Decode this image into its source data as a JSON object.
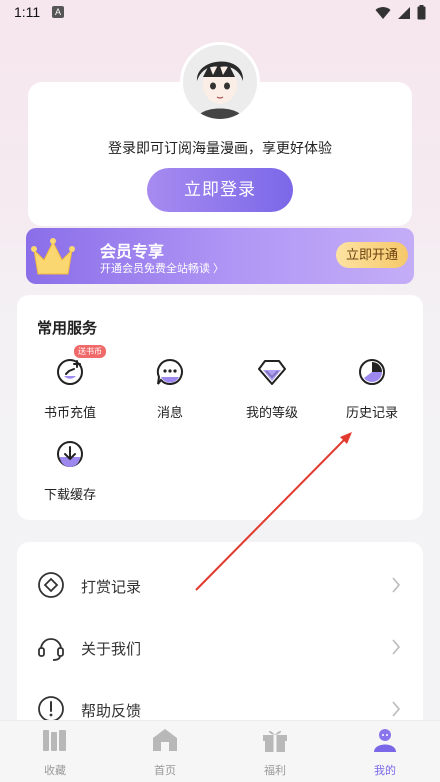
{
  "status": {
    "time": "1:11",
    "notif": "A"
  },
  "login": {
    "tip": "登录即可订阅海量漫画，享更好体验",
    "button": "立即登录"
  },
  "vip": {
    "title": "会员专享",
    "subtitle": "开通会员免费全站畅读 〉",
    "button": "立即开通"
  },
  "services": {
    "title": "常用服务",
    "items": [
      {
        "label": "书币充值",
        "badge": "送书币",
        "icon": "coin-icon"
      },
      {
        "label": "消息",
        "icon": "message-icon"
      },
      {
        "label": "我的等级",
        "icon": "diamond-icon"
      },
      {
        "label": "历史记录",
        "icon": "history-icon"
      },
      {
        "label": "下载缓存",
        "icon": "download-icon"
      }
    ]
  },
  "menu": {
    "items": [
      {
        "label": "打赏记录",
        "icon": "reward-icon"
      },
      {
        "label": "关于我们",
        "icon": "headset-icon"
      },
      {
        "label": "帮助反馈",
        "icon": "help-icon"
      }
    ]
  },
  "tabs": [
    {
      "label": "收藏",
      "icon": "bookshelf-icon"
    },
    {
      "label": "首页",
      "icon": "home-icon"
    },
    {
      "label": "福利",
      "icon": "gift-icon"
    },
    {
      "label": "我的",
      "icon": "profile-icon",
      "active": true
    }
  ],
  "colors": {
    "accent": "#7b68e8",
    "vip_gold": "#f6c86a",
    "badge": "#f16a6a"
  }
}
